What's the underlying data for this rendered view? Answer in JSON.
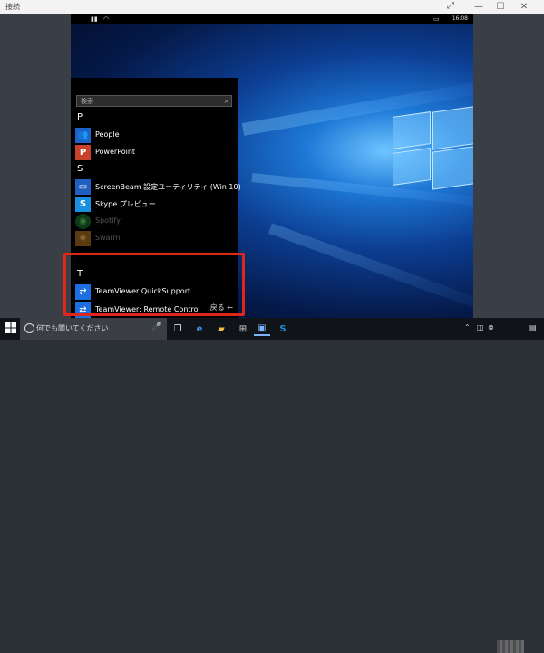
{
  "window": {
    "title": "接続",
    "expand_glyph": "⤢",
    "minimize_glyph": "—",
    "maximize_glyph": "☐",
    "close_glyph": "✕"
  },
  "phone_status": {
    "clock": "16:08"
  },
  "start_menu": {
    "search_placeholder": "検索",
    "sections": [
      {
        "letter": "P",
        "apps": [
          {
            "name": "People",
            "icon": "people-icon",
            "color": "#1d62c9"
          },
          {
            "name": "PowerPoint",
            "icon": "powerpoint-icon",
            "color": "#c8412a"
          }
        ]
      },
      {
        "letter": "S",
        "apps": [
          {
            "name": "ScreenBeam 設定ユーティリティ (Win 10)",
            "icon": "screenbeam-icon",
            "color": "#1f5fbf"
          },
          {
            "name": "Skype プレビュー",
            "icon": "skype-icon",
            "color": "#1a8fe0"
          },
          {
            "name": "Spotify",
            "icon": "spotify-icon",
            "color": "#0f3a17"
          },
          {
            "name": "Swarm",
            "icon": "swarm-icon",
            "color": "#5a3a10"
          }
        ]
      },
      {
        "letter": "T",
        "apps": [
          {
            "name": "TeamViewer QuickSupport",
            "icon": "teamviewer-icon",
            "color": "#1c6fe0"
          },
          {
            "name": "TeamViewer: Remote Control",
            "icon": "teamviewer-icon",
            "color": "#1c6fe0"
          }
        ]
      }
    ],
    "back_label": "戻る ←"
  },
  "taskbar": {
    "search_placeholder": "何でも聞いてください",
    "icons": [
      "windows-start-icon",
      "task-view-icon",
      "edge-icon",
      "file-explorer-icon",
      "store-icon",
      "connect-icon",
      "skype-icon"
    ]
  },
  "colors": {
    "highlight": "#e0261a",
    "accent": "#1d78d6"
  }
}
